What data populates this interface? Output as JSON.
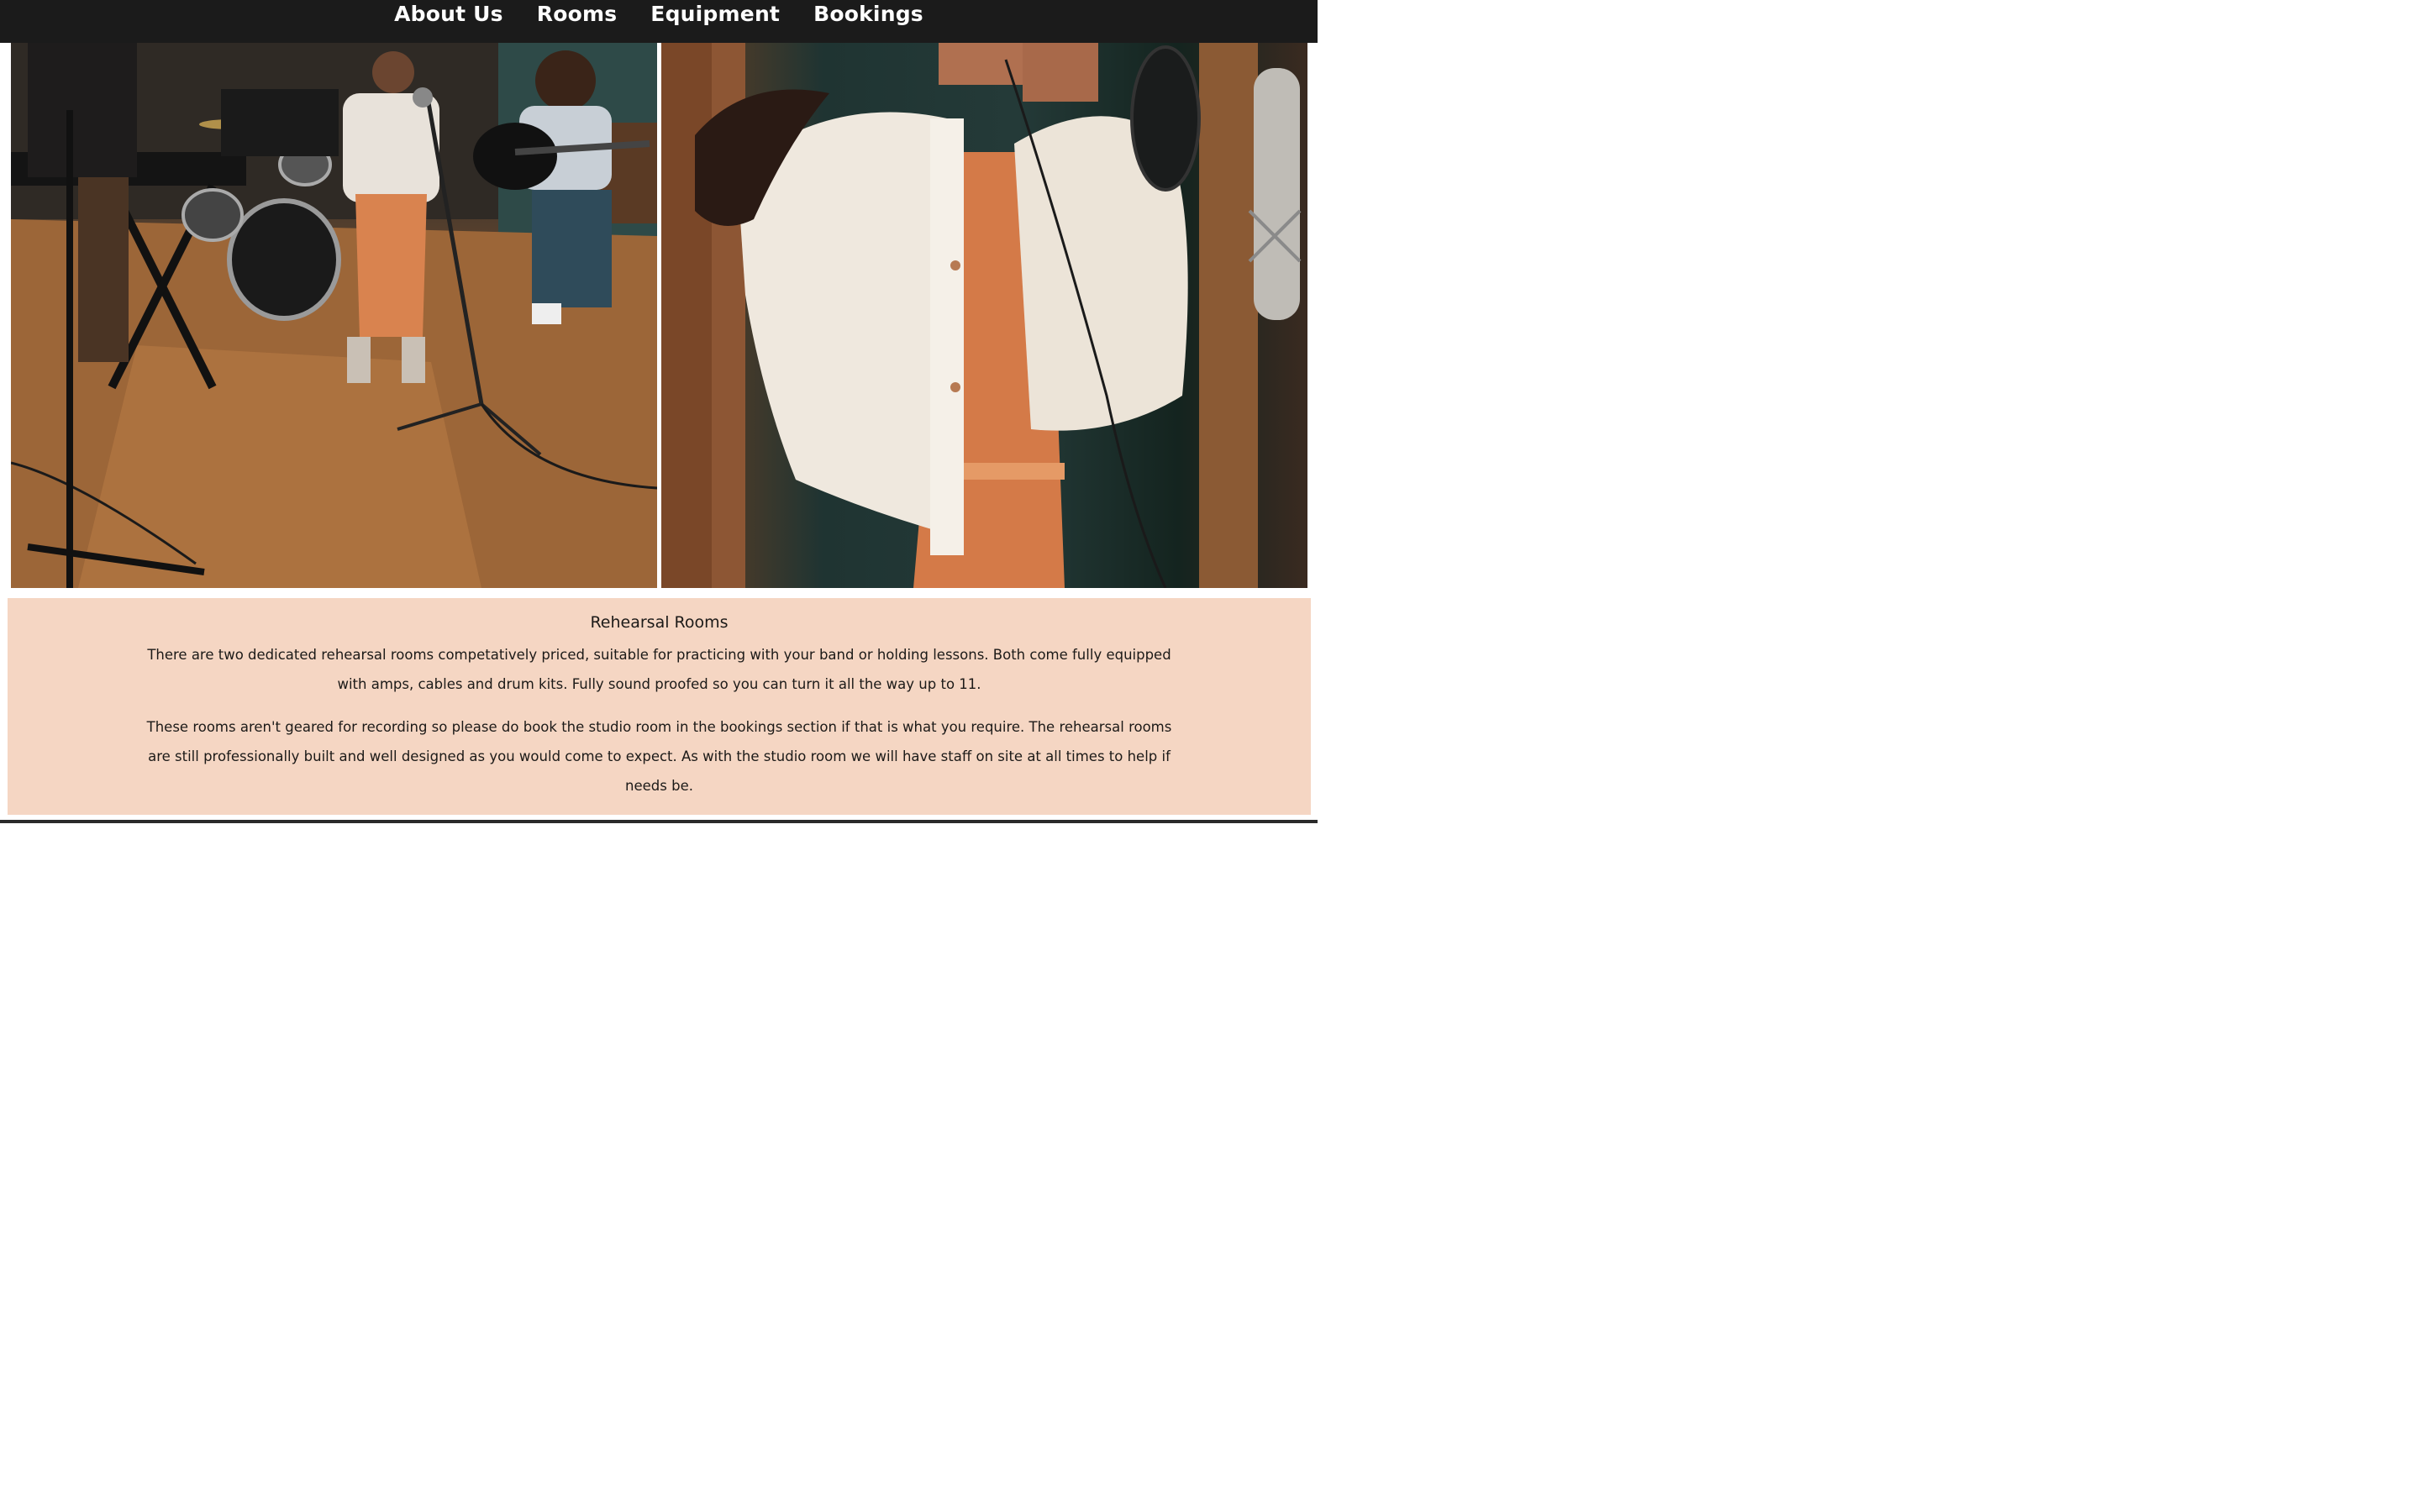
{
  "nav": {
    "items": [
      {
        "label": "About Us"
      },
      {
        "label": "Rooms"
      },
      {
        "label": "Equipment"
      },
      {
        "label": "Bookings"
      }
    ]
  },
  "rehearsal": {
    "title": "Rehearsal Rooms",
    "paragraph1": "There are two dedicated rehearsal rooms competatively priced, suitable for practicing with your band or holding lessons. Both come fully equipped with amps, cables and drum kits. Fully sound proofed so you can turn it all the way up to 11.",
    "paragraph2": "These rooms aren't geared for recording so please do book the studio room in the bookings section if that is what you require. The rehearsal rooms are still professionally built and well designed as you would come to expect. As with the studio room we will have staff on site at all times to help if needs be."
  },
  "colors": {
    "nav_bg": "#1b1b1b",
    "info_bg": "#f5d6c3"
  }
}
